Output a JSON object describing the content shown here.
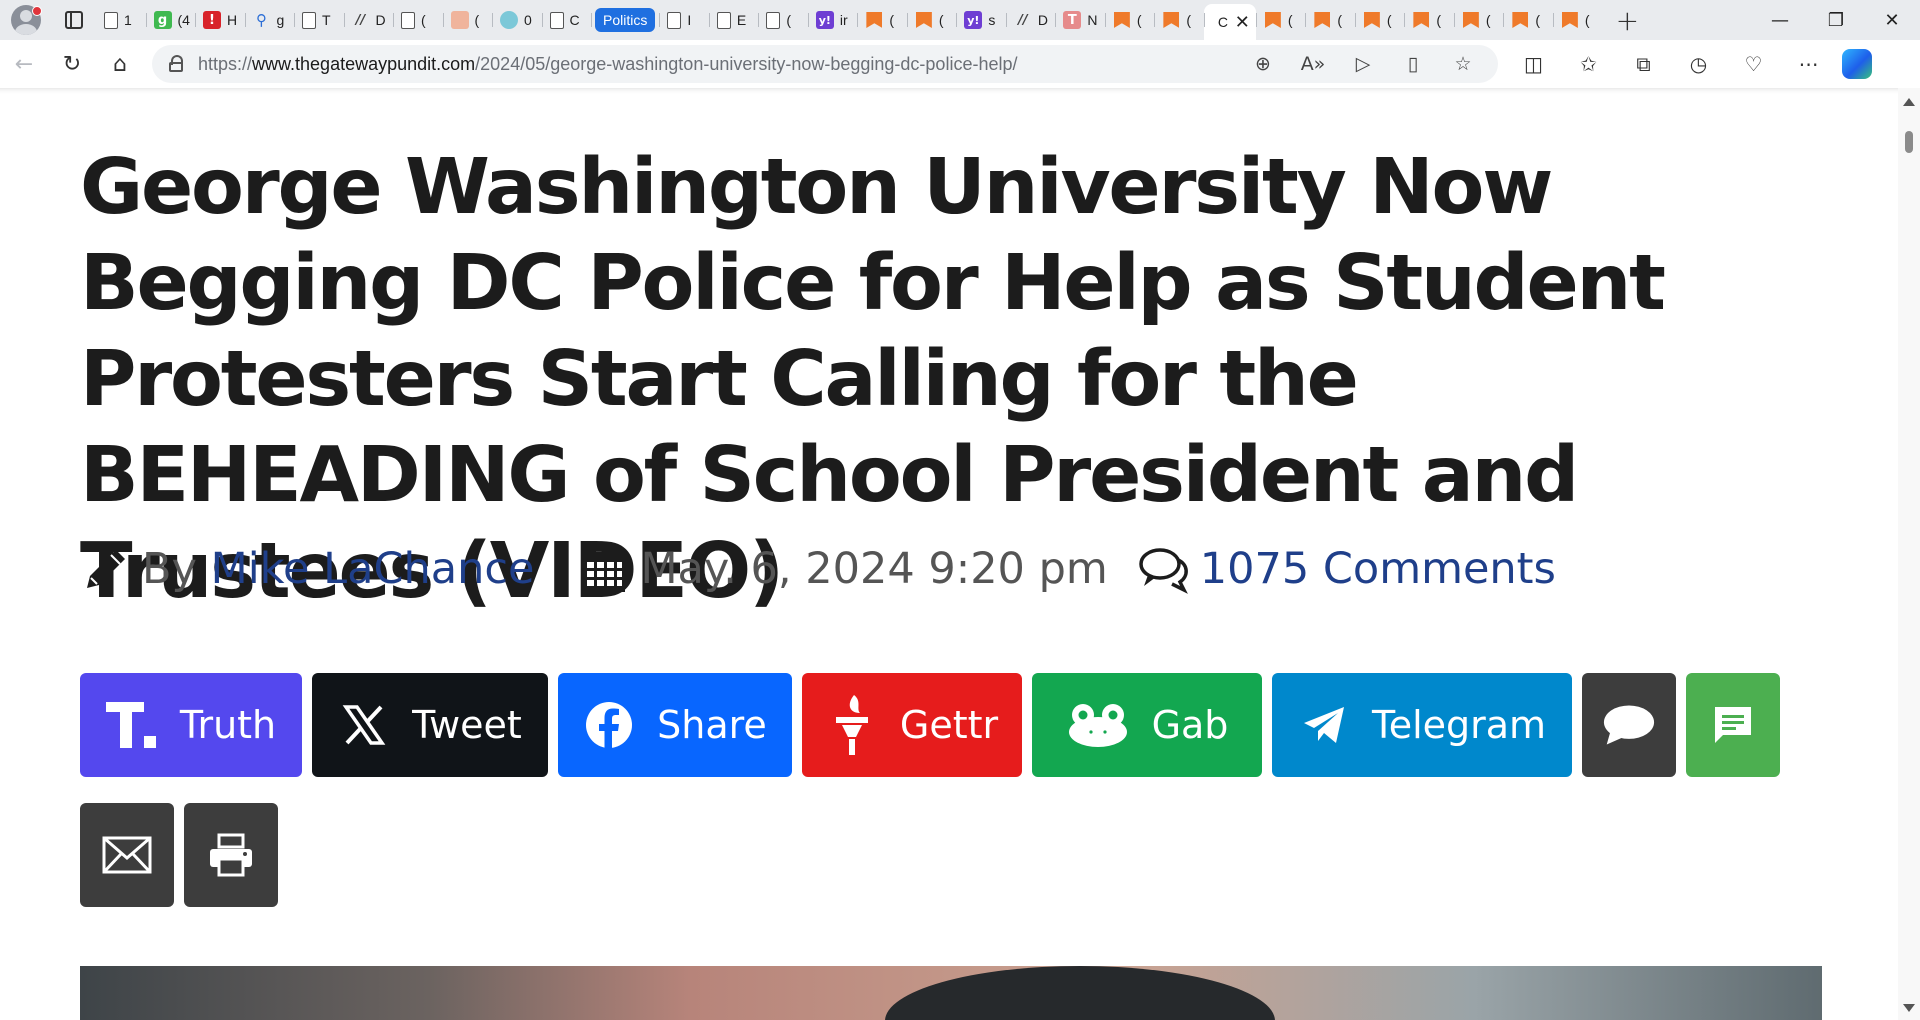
{
  "browser": {
    "tabs": [
      {
        "icon": "doc-icon",
        "title": "1"
      },
      {
        "icon": "g-icon",
        "title": "(4"
      },
      {
        "icon": "red-icon",
        "title": "H"
      },
      {
        "icon": "search-icon",
        "title": "g"
      },
      {
        "icon": "doc-icon",
        "title": "T"
      },
      {
        "icon": "slash-icon",
        "title": "D"
      },
      {
        "icon": "doc-icon",
        "title": "("
      },
      {
        "icon": "peach-icon",
        "title": "("
      },
      {
        "icon": "teal-icon",
        "title": "0"
      },
      {
        "icon": "doc-icon",
        "title": "C"
      }
    ],
    "group_label": "Politics",
    "tabs_after": [
      {
        "icon": "doc-icon",
        "title": "I"
      },
      {
        "icon": "doc-icon",
        "title": "E"
      },
      {
        "icon": "doc-icon",
        "title": "("
      },
      {
        "icon": "yahoo-icon",
        "title": "ir"
      },
      {
        "icon": "bookmark-icon",
        "title": "("
      },
      {
        "icon": "bookmark-icon",
        "title": "("
      },
      {
        "icon": "yahoo-icon",
        "title": "s"
      },
      {
        "icon": "slash-icon",
        "title": "D"
      },
      {
        "icon": "pinkT-icon",
        "title": "N"
      },
      {
        "icon": "bookmark-icon",
        "title": "("
      },
      {
        "icon": "bookmark-icon",
        "title": "("
      }
    ],
    "active_tab": {
      "title": "C"
    },
    "tabs_end": [
      {
        "icon": "bookmark-icon",
        "title": "("
      },
      {
        "icon": "bookmark-icon",
        "title": "("
      },
      {
        "icon": "bookmark-icon",
        "title": "("
      },
      {
        "icon": "bookmark-icon",
        "title": "("
      },
      {
        "icon": "bookmark-icon",
        "title": "("
      },
      {
        "icon": "bookmark-icon",
        "title": "("
      },
      {
        "icon": "bookmark-icon",
        "title": "("
      }
    ],
    "url_prefix": "https://",
    "url_host": "www.thegatewaypundit.com",
    "url_path": "/2024/05/george-washington-university-now-begging-dc-police-help/"
  },
  "article": {
    "headline": "George Washington University Now Begging DC Police for Help as Student Protesters Start Calling for the BEHEADING of School President and Trustees (VIDEO)",
    "by_label": "By",
    "author": "Mike LaChance",
    "date": "May. 6, 2024 9:20 pm",
    "comments": "1075 Comments"
  },
  "share_buttons": [
    {
      "label": "Truth",
      "color": "#5448ee",
      "icon": "truth-social-icon"
    },
    {
      "label": "Tweet",
      "color": "#101418",
      "icon": "x-icon"
    },
    {
      "label": "Share",
      "color": "#0866ff",
      "icon": "facebook-icon"
    },
    {
      "label": "Gettr",
      "color": "#e61c1c",
      "icon": "gettr-torch-icon"
    },
    {
      "label": "Gab",
      "color": "#13a750",
      "icon": "gab-frog-icon"
    },
    {
      "label": "Telegram",
      "color": "#0088cc",
      "icon": "telegram-icon"
    },
    {
      "label": "",
      "color": "#3d3d3d",
      "icon": "comment-bubble-icon"
    },
    {
      "label": "",
      "color": "#4caf50",
      "icon": "sms-icon"
    },
    {
      "label": "",
      "color": "#3d3d3d",
      "icon": "email-icon"
    },
    {
      "label": "",
      "color": "#3d3d3d",
      "icon": "print-icon"
    }
  ]
}
